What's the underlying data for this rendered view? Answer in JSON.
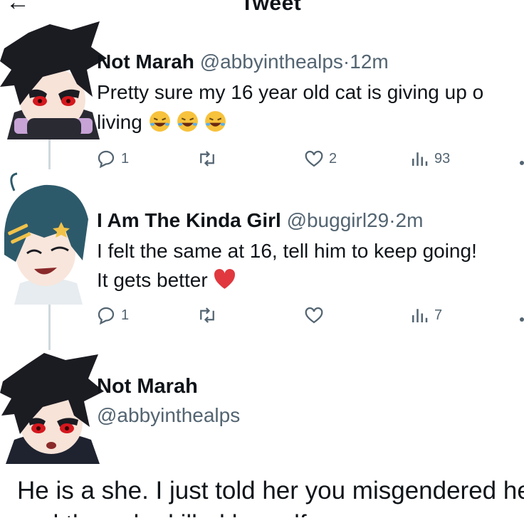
{
  "header": {
    "title": "Tweet"
  },
  "tweets": [
    {
      "name": "Not Marah",
      "handle": "@abbyinthealps",
      "separator": "·",
      "time": "12m",
      "line1": "Pretty sure my 16 year old cat is giving up o",
      "line2": "living",
      "emojis": [
        "rofl-emoji",
        "rofl-emoji",
        "rofl-emoji"
      ],
      "replies": "1",
      "likes": "2",
      "views": "93"
    },
    {
      "name": "I Am The Kinda Girl",
      "handle": "@buggirl29",
      "separator": "·",
      "time": "2m",
      "line1": "I felt the same at 16, tell him to keep going!",
      "line2": "It gets better",
      "emojis": [
        "red-heart-emoji"
      ],
      "replies": "1",
      "views": "7"
    }
  ],
  "main_tweet": {
    "name": "Not Marah",
    "handle": "@abbyinthealps",
    "line1": "He is a she. I just told her you misgendered he",
    "line2": "and then she killed herself"
  },
  "colors": {
    "text": "#0f1419",
    "secondary": "#536471",
    "thread_line": "#cfd9de",
    "heart": "#e0383e"
  },
  "icons": [
    "back-arrow-icon",
    "reply-icon",
    "retweet-icon",
    "like-icon",
    "views-icon"
  ]
}
